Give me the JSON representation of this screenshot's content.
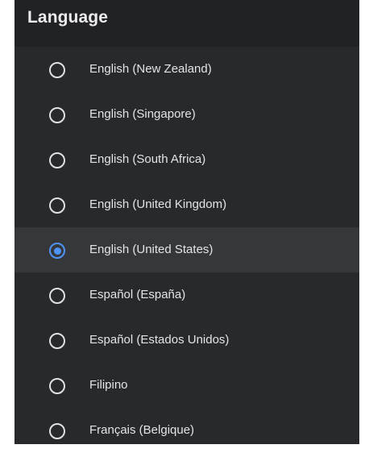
{
  "dialog": {
    "title": "Language",
    "accent_color": "#4f93f6",
    "selected_index": 4,
    "options": [
      {
        "label": "English (New Zealand)",
        "selected": false
      },
      {
        "label": "English (Singapore)",
        "selected": false
      },
      {
        "label": "English (South Africa)",
        "selected": false
      },
      {
        "label": "English (United Kingdom)",
        "selected": false
      },
      {
        "label": "English (United States)",
        "selected": true
      },
      {
        "label": "Español (España)",
        "selected": false
      },
      {
        "label": "Español (Estados Unidos)",
        "selected": false
      },
      {
        "label": "Filipino",
        "selected": false
      },
      {
        "label": "Français (Belgique)",
        "selected": false
      }
    ]
  }
}
